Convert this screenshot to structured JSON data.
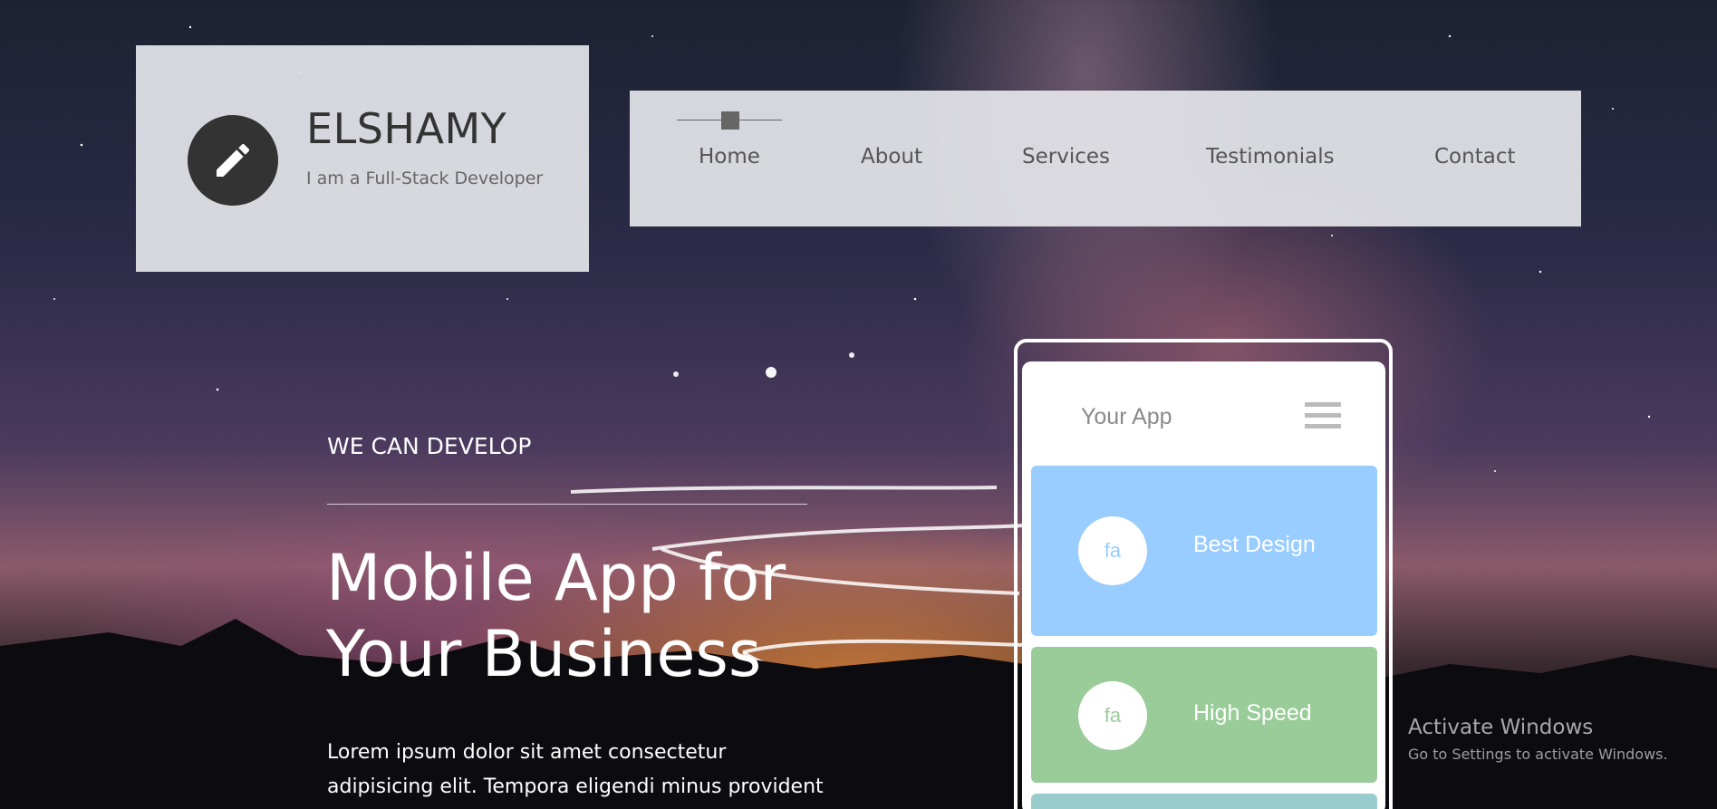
{
  "brand": {
    "title": "ELSHAMY",
    "subtitle": "I am a Full-Stack Developer",
    "logo_icon": "pencil-icon"
  },
  "nav": {
    "items": [
      {
        "label": "Home"
      },
      {
        "label": "About"
      },
      {
        "label": "Services"
      },
      {
        "label": "Testimonials"
      },
      {
        "label": "Contact"
      }
    ]
  },
  "hero": {
    "kicker": "WE CAN DEVELOP",
    "title_line1": "Mobile App for",
    "title_line2": "Your Business",
    "text_line1": "Lorem ipsum dolor sit amet consectetur",
    "text_line2": "adipisicing elit. Tempora eligendi minus provident"
  },
  "phone": {
    "app_title": "Your App",
    "cards": [
      {
        "icon_text": "fa",
        "label": "Best Design",
        "color": "#99ccff",
        "icon_color": "#99ccff"
      },
      {
        "icon_text": "fa",
        "label": "High Speed",
        "color": "#99cc99",
        "icon_color": "#99cc99"
      },
      {
        "icon_text": "",
        "label": "",
        "color": "#99cccc",
        "icon_color": "#99cccc"
      }
    ]
  },
  "watermark": {
    "title": "Activate Windows",
    "subtitle": "Go to Settings to activate Windows."
  },
  "colors": {
    "panel": "#e6e6eb",
    "logo_bg": "#333333",
    "accent_blue": "#99ccff",
    "accent_green": "#99cc99",
    "accent_teal": "#99cccc"
  }
}
